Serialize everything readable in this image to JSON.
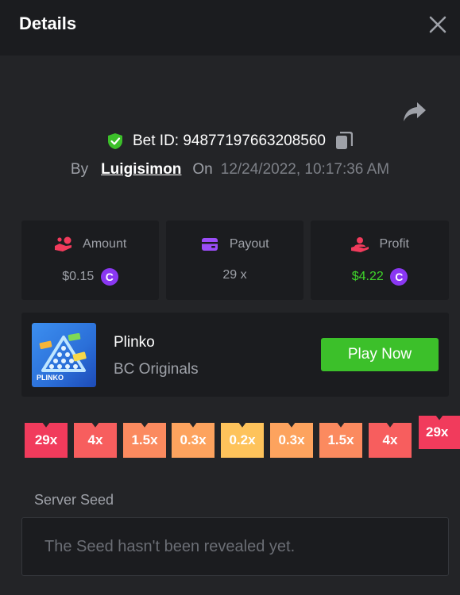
{
  "header": {
    "title": "Details",
    "close_icon": "close-icon"
  },
  "share": {
    "icon": "share-icon"
  },
  "bet": {
    "id_label": "Bet ID: 94877197663208560",
    "shield_icon": "shield-check-icon",
    "copy_icon": "copy-icon"
  },
  "by_row": {
    "by_label": "By",
    "username": "Luigisimon",
    "on_label": "On",
    "datetime": "12/24/2022, 10:17:36 AM"
  },
  "stats": [
    {
      "label": "Amount",
      "value": "$0.15",
      "icon": "hand-coins-icon",
      "coin": "C"
    },
    {
      "label": "Payout",
      "value": "29 x",
      "icon": "wallet-icon"
    },
    {
      "label": "Profit",
      "value": "$4.22",
      "icon": "hand-user-icon",
      "coin": "C"
    }
  ],
  "game": {
    "name": "Plinko",
    "category": "BC Originals",
    "play_label": "Play Now",
    "thumb_text": "PLINKO"
  },
  "multipliers": [
    "29x",
    "4x",
    "1.5x",
    "0.3x",
    "0.2x",
    "0.3x",
    "1.5x",
    "4x",
    "29x"
  ],
  "seed": {
    "label": "Server Seed",
    "placeholder": "The Seed hasn't been revealed yet."
  },
  "colors": {
    "accent_green": "#3cc02a",
    "profit_green": "#3fd42a",
    "coin_purple": "#8a37f2",
    "multiplier_red": "#f13b5c",
    "multiplier_coral": "#f75e5e",
    "multiplier_orange": "#fb8a5f",
    "multiplier_peach": "#fda35e",
    "multiplier_yellow": "#fec35b"
  }
}
